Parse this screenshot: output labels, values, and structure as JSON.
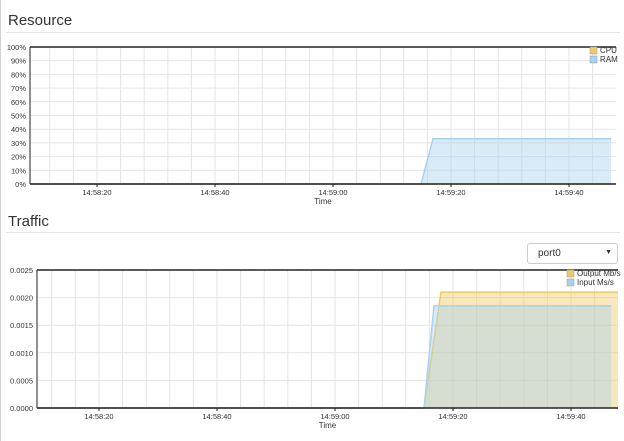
{
  "resource": {
    "title": "Resource",
    "chart_data": {
      "type": "area",
      "xlabel": "Time",
      "x_ticks": [
        "14:58:20",
        "14:58:40",
        "14:59:00",
        "14:59:20",
        "14:59:40"
      ],
      "y_ticks": [
        "0%",
        "10%",
        "20%",
        "30%",
        "40%",
        "50%",
        "60%",
        "70%",
        "80%",
        "90%",
        "100%"
      ],
      "ylim": [
        0,
        100
      ],
      "grid": true,
      "legend_position": "top-right",
      "series": [
        {
          "name": "CPU",
          "color": "#f0ca66",
          "values": [
            0,
            0,
            0,
            0,
            0
          ]
        },
        {
          "name": "RAM",
          "color": "#aad2ee",
          "values": [
            0,
            0,
            0,
            33,
            33
          ]
        }
      ]
    }
  },
  "traffic": {
    "title": "Traffic",
    "port_select": {
      "value": "port0"
    },
    "chart_data": {
      "type": "area",
      "xlabel": "Time",
      "x_ticks": [
        "14:58:20",
        "14:58:40",
        "14:59:00",
        "14:59:20",
        "14:59:40"
      ],
      "y_ticks": [
        "0.0000",
        "0.0005",
        "0.0010",
        "0.0015",
        "0.0020",
        "0.0025"
      ],
      "ylim": [
        0,
        0.0025
      ],
      "grid": true,
      "legend_position": "top-right",
      "series": [
        {
          "name": "Output Mb/s",
          "color": "#f0ca66",
          "values": [
            0,
            0,
            0,
            0.0021,
            0.0021
          ]
        },
        {
          "name": "Input Ms/s",
          "color": "#aad2ee",
          "values": [
            0,
            0,
            0,
            0.00185,
            0.00185
          ]
        }
      ]
    }
  }
}
